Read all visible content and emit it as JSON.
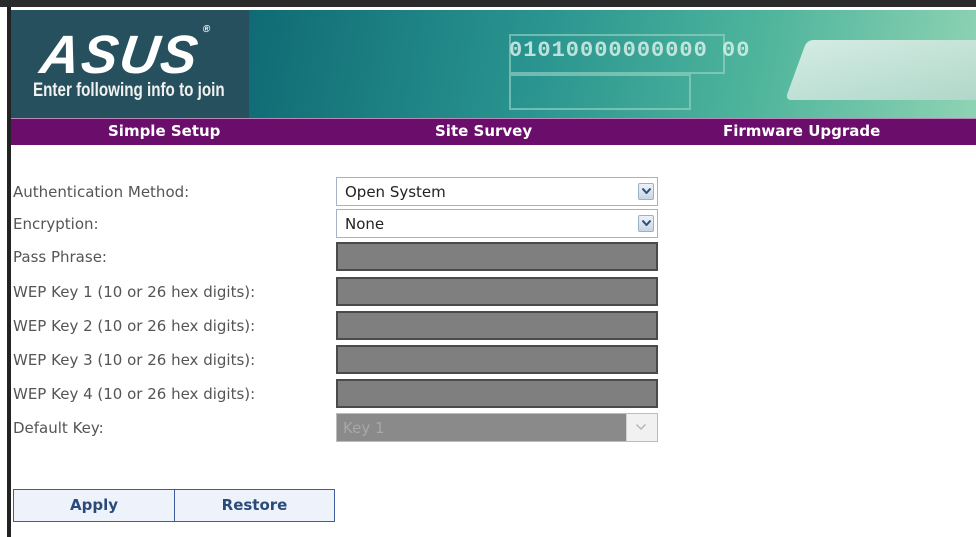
{
  "header": {
    "logo_text": "ASUS",
    "tagline": "Enter following info to join",
    "banner_digits": "01010000000000 00"
  },
  "nav": {
    "items": [
      "Simple Setup",
      "Site Survey",
      "Firmware Upgrade"
    ]
  },
  "form": {
    "auth_method": {
      "label": "Authentication Method:",
      "value": "Open System"
    },
    "encryption": {
      "label": "Encryption:",
      "value": "None"
    },
    "pass_phrase": {
      "label": "Pass Phrase:",
      "value": ""
    },
    "wep_key_1": {
      "label": "WEP Key 1 (10 or 26 hex digits):",
      "value": ""
    },
    "wep_key_2": {
      "label": "WEP Key 2 (10 or 26 hex digits):",
      "value": ""
    },
    "wep_key_3": {
      "label": "WEP Key 3 (10 or 26 hex digits):",
      "value": ""
    },
    "wep_key_4": {
      "label": "WEP Key 4 (10 or 26 hex digits):",
      "value": ""
    },
    "default_key": {
      "label": "Default Key:",
      "value": "Key 1"
    }
  },
  "buttons": {
    "apply": "Apply",
    "restore": "Restore"
  },
  "colors": {
    "nav_bg": "#6b0e6b",
    "banner_accent": "#2a9590",
    "button_border": "#3a5f9c"
  },
  "icons": {
    "dropdown": "chevron-down-icon"
  }
}
